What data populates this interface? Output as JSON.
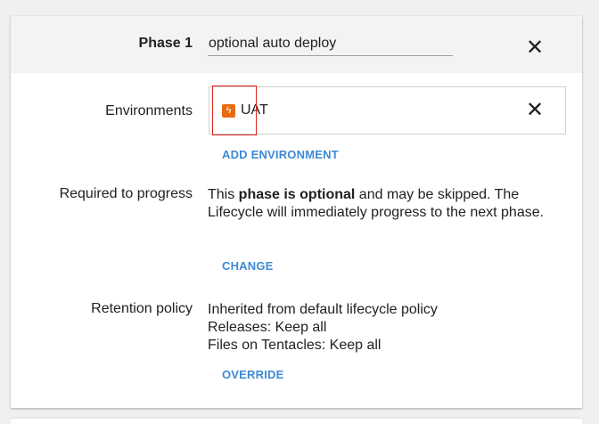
{
  "phase": {
    "label": "Phase 1",
    "name_value": "optional auto deploy",
    "close_glyph": "✕"
  },
  "environments": {
    "label": "Environments",
    "items": [
      {
        "name": "UAT",
        "icon": "lightning-bolt-icon",
        "icon_glyph": "ϟ",
        "icon_color": "#e86c12"
      }
    ],
    "remove_glyph": "✕",
    "add_label": "ADD ENVIRONMENT"
  },
  "required": {
    "label": "Required to progress",
    "text_prefix": "This ",
    "text_bold": "phase is optional",
    "text_suffix": " and may be skipped. The Lifecycle will immediately progress to the next phase.",
    "change_label": "CHANGE"
  },
  "retention": {
    "label": "Retention policy",
    "lines": [
      "Inherited from default lifecycle policy",
      "Releases: Keep all",
      "Files on Tentacles: Keep all"
    ],
    "override_label": "OVERRIDE"
  },
  "colors": {
    "link": "#3d8ad6",
    "env_icon": "#e86c12",
    "highlight_box": "#e02020"
  }
}
